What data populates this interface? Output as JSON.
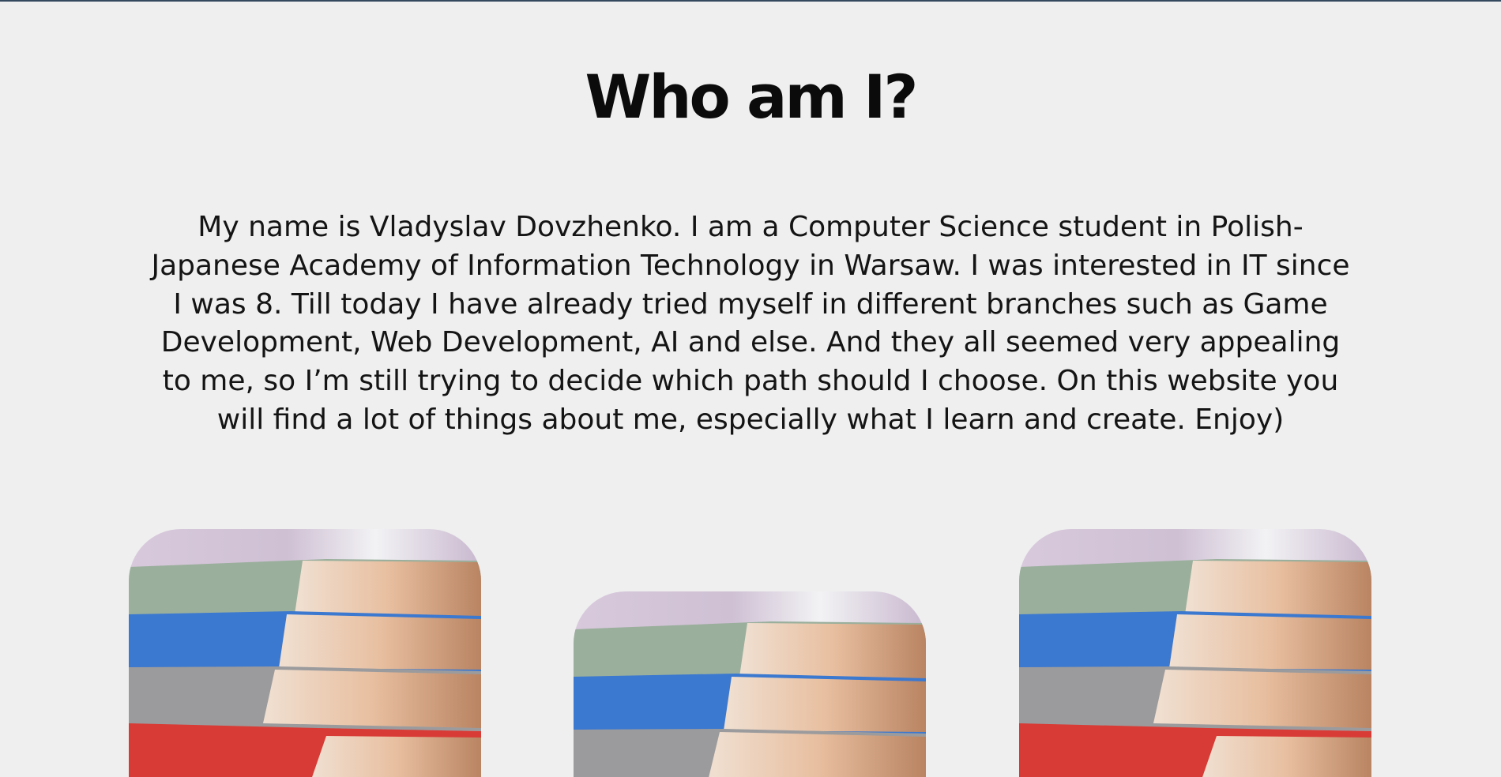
{
  "heading": {
    "title": "Who am I?"
  },
  "about": {
    "paragraph": "My name is Vladyslav Dovzhenko. I am a Computer Science student in Polish-Japanese Academy of Information Technology in Warsaw. I was interested in IT since I was 8. Till today I have already tried myself in different branches such as Game Development, Web Development, AI and else. And they all seemed very appealing to me, so I’m still trying to decide which path should I choose. On this website you will find a lot of things about me, especially what I learn and create. Enjoy)"
  },
  "gallery": {
    "images": [
      {
        "subject": "stack-of-books-photo"
      },
      {
        "subject": "stack-of-books-photo"
      },
      {
        "subject": "stack-of-books-photo"
      }
    ]
  },
  "colors": {
    "background": "#efefef",
    "text": "#0b0b0b",
    "top_border": "#34495e"
  }
}
